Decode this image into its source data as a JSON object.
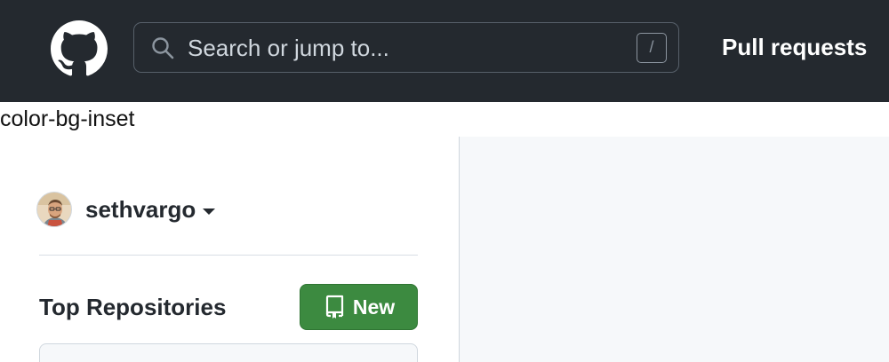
{
  "header": {
    "logo_icon": "github-mark-icon",
    "search": {
      "placeholder": "Search or jump to...",
      "icon": "search-icon",
      "shortcut_key": "/"
    },
    "nav": {
      "pull_requests": "Pull requests"
    }
  },
  "debug_label": "color-bg-inset",
  "sidebar": {
    "user": {
      "username": "sethvargo",
      "avatar_icon": "avatar",
      "caret_icon": "caret-down-icon"
    },
    "top_repositories": {
      "heading": "Top Repositories",
      "new_button_label": "New",
      "new_button_icon": "repo-icon"
    }
  },
  "colors": {
    "header_bg": "#24292f",
    "new_button_bg": "#3c8a40",
    "inset_bg": "#f6f8fa"
  }
}
